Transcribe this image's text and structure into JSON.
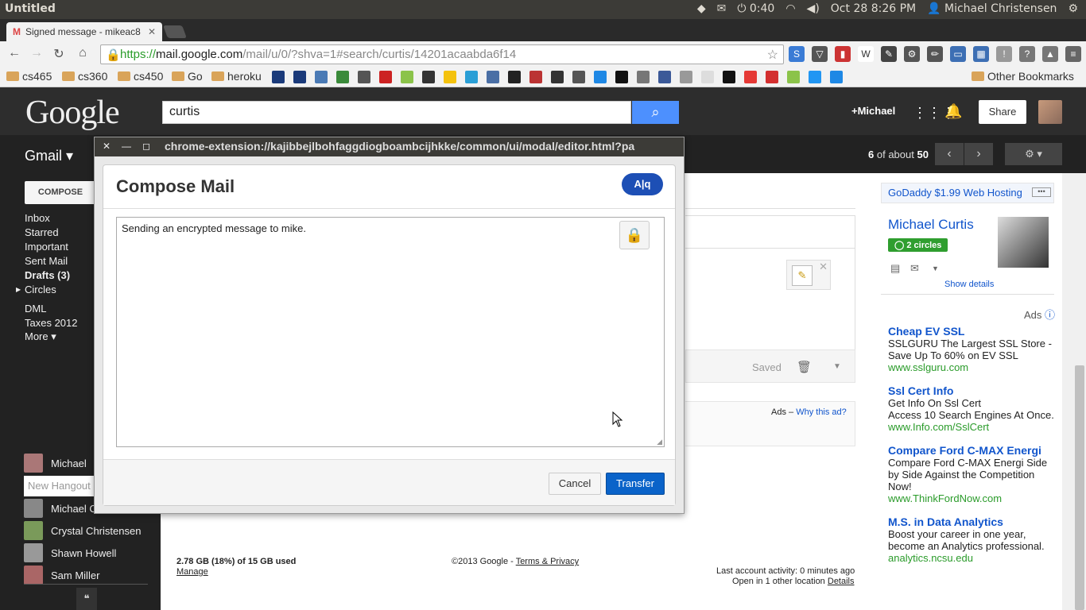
{
  "os": {
    "window_title": "Untitled",
    "clock": "0:40",
    "datetime": "Oct 28  8:26 PM",
    "user": "Michael Christensen"
  },
  "browser": {
    "tab_title": "Signed message - mikeac8",
    "url_scheme": "https://",
    "url_host": "mail.google.com",
    "url_path": "/mail/u/0/?shva=1#search/curtis/14201acaabda6f14",
    "bookmarks": [
      "cs465",
      "cs360",
      "cs450",
      "Go",
      "heroku"
    ],
    "other_bookmarks": "Other Bookmarks"
  },
  "google": {
    "logo": "Google",
    "search_value": "curtis",
    "plus_name": "+Michael",
    "share_label": "Share"
  },
  "gmail": {
    "label": "Gmail ▾",
    "count_prefix": "6",
    "count_suffix": "of about",
    "count_total": "50",
    "compose_label": "COMPOSE",
    "nav": [
      "Inbox",
      "Starred",
      "Important",
      "Sent Mail",
      "Drafts (3)",
      "Circles",
      "DML",
      "Taxes 2012",
      "More ▾"
    ],
    "hangout_user": "Michael",
    "new_hangout_placeholder": "New Hangout",
    "contacts": [
      "Michael C",
      "Crystal Christensen",
      "Shawn Howell",
      "Sam Miller"
    ],
    "saved_label": "Saved",
    "ads_label": "Ads –",
    "why_ad": "Why this ad?",
    "storage": "2.78 GB (18%) of 15 GB used",
    "manage": "Manage",
    "copyright": "©2013 Google -",
    "terms": "Terms & Privacy",
    "last_activity": "Last account activity: 0 minutes ago",
    "open_location": "Open in 1 other location",
    "details": "Details"
  },
  "rightpanel": {
    "top_ad": "GoDaddy $1.99 Web Hosting",
    "contact_name": "Michael Curtis",
    "circles_badge": "2 circles",
    "show_details": "Show details",
    "ads_header": "Ads",
    "ads": [
      {
        "title": "Cheap EV SSL",
        "text": "SSLGURU The Largest SSL Store - Save Up To 60% on EV SSL",
        "url": "www.sslguru.com"
      },
      {
        "title": "Ssl Cert Info",
        "text": "Get Info On Ssl Cert\nAccess 10 Search Engines At Once.",
        "url": "www.Info.com/SslCert"
      },
      {
        "title": "Compare Ford C-MAX Energi",
        "text": "Compare Ford C-MAX Energi Side by Side Against the Competition Now!",
        "url": "www.ThinkFordNow.com"
      },
      {
        "title": "M.S. in Data Analytics",
        "text": "Boost your career in one year, become an Analytics professional.",
        "url": "analytics.ncsu.edu"
      }
    ]
  },
  "modal": {
    "window_url": "chrome-extension://kajibbejlbohfaggdiogboambcijhkke/common/ui/modal/editor.html?pa",
    "title": "Compose Mail",
    "aq_label": "A|q",
    "body_text": "Sending an encrypted message to mike.",
    "cancel_label": "Cancel",
    "transfer_label": "Transfer"
  }
}
